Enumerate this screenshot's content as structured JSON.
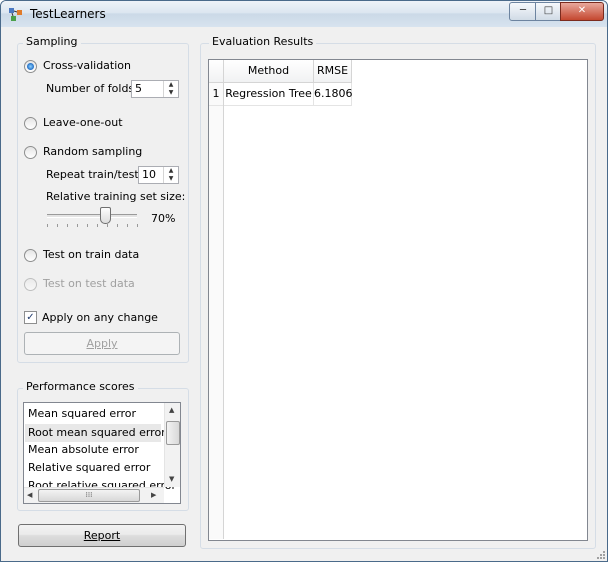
{
  "window": {
    "title": "TestLearners",
    "controls": {
      "minimize": "─",
      "maximize": "□",
      "close": "✕"
    }
  },
  "sampling": {
    "group_title": "Sampling",
    "cross_validation": {
      "label": "Cross-validation",
      "selected": true
    },
    "folds": {
      "label": "Number of folds:",
      "value": "5"
    },
    "leave_one_out": {
      "label": "Leave-one-out"
    },
    "random_sampling": {
      "label": "Random sampling",
      "repeat_label": "Repeat train/test:",
      "repeat_value": "10",
      "train_size_label": "Relative training set size:",
      "train_size_value": "70%",
      "train_size_fraction": 0.7
    },
    "train_data": {
      "label": "Test on train data"
    },
    "test_data": {
      "label": "Test on test data",
      "disabled": true
    },
    "apply_on_change": {
      "label": "Apply on any change",
      "checked": true
    },
    "apply_button": "Apply"
  },
  "performance": {
    "group_title": "Performance scores",
    "items": [
      "Mean squared error",
      "Root mean squared error",
      "Mean absolute error",
      "Relative squared error",
      "Root relative squared error"
    ],
    "selected_index": 1
  },
  "report_button": "Report",
  "results": {
    "group_title": "Evaluation Results",
    "columns": [
      "Method",
      "RMSE"
    ],
    "rows": [
      {
        "index": "1",
        "method": "Regression Tree",
        "rmse": "6.1806"
      }
    ]
  },
  "icons": {
    "app": "orange-widget-icon",
    "spin_up": "▲",
    "spin_down": "▼",
    "check": "✓",
    "scroll_up": "▲",
    "scroll_down": "▼",
    "scroll_left": "◀",
    "scroll_right": "▶",
    "grip": "⁞⁞⁞"
  }
}
